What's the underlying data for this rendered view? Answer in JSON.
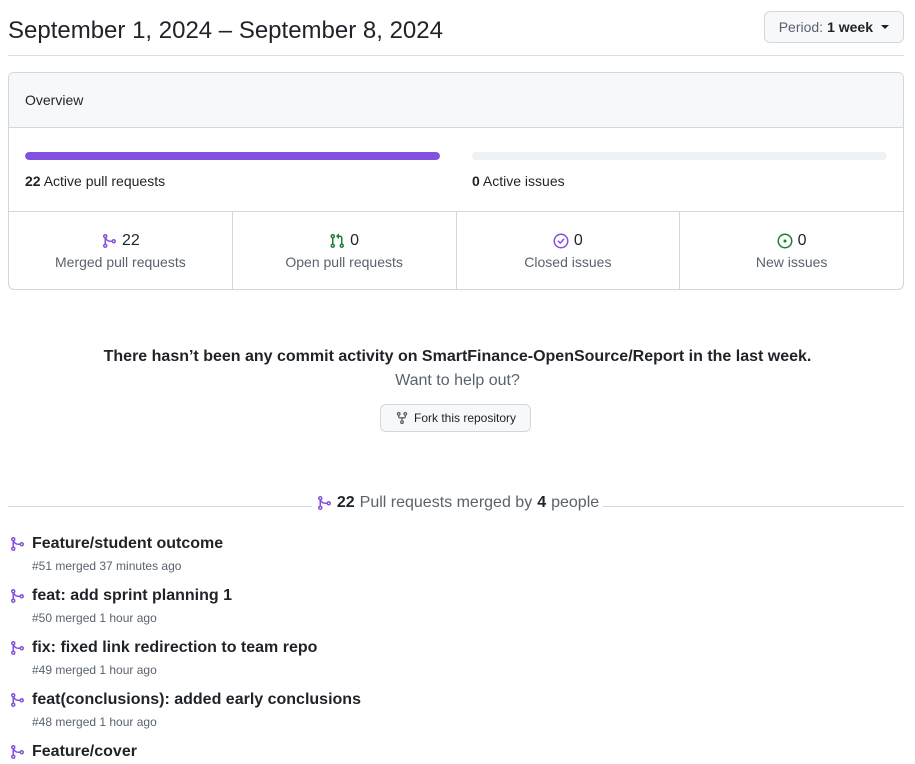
{
  "header": {
    "date_range": "September 1, 2024 – September 8, 2024",
    "period_label": "Period:",
    "period_value": "1 week"
  },
  "overview": {
    "title": "Overview",
    "pull_requests_bar": {
      "count": "22",
      "label": "Active pull requests",
      "fill_fraction": 1.0
    },
    "issues_bar": {
      "count": "0",
      "label": "Active issues",
      "fill_fraction": 0
    },
    "stats": [
      {
        "value": "22",
        "label": "Merged pull requests",
        "icon": "git-merge-icon",
        "color": "#8250df"
      },
      {
        "value": "0",
        "label": "Open pull requests",
        "icon": "git-pull-request-icon",
        "color": "#1a7f37"
      },
      {
        "value": "0",
        "label": "Closed issues",
        "icon": "issue-closed-icon",
        "color": "#8250df"
      },
      {
        "value": "0",
        "label": "New issues",
        "icon": "issue-opened-icon",
        "color": "#1a7f37"
      }
    ]
  },
  "commit_activity": {
    "message": "There hasn’t been any commit activity on SmartFinance-OpenSource/Report in the last week.",
    "prompt": "Want to help out?",
    "fork_button": "Fork this repository"
  },
  "merged_summary": {
    "count": "22",
    "text": "Pull requests merged by",
    "people_count": "4",
    "people_label": "people"
  },
  "pull_requests": [
    {
      "title": "Feature/student outcome",
      "meta": "#51 merged 37 minutes ago"
    },
    {
      "title": "feat: add sprint planning 1",
      "meta": "#50 merged 1 hour ago"
    },
    {
      "title": "fix: fixed link redirection to team repo",
      "meta": "#49 merged 1 hour ago"
    },
    {
      "title": "feat(conclusions): added early conclusions",
      "meta": "#48 merged 1 hour ago"
    },
    {
      "title": "Feature/cover",
      "meta": ""
    }
  ],
  "colors": {
    "merged_purple": "#8250df",
    "open_green": "#1a7f37",
    "muted_text": "#59636e",
    "border": "#d0d7de"
  }
}
